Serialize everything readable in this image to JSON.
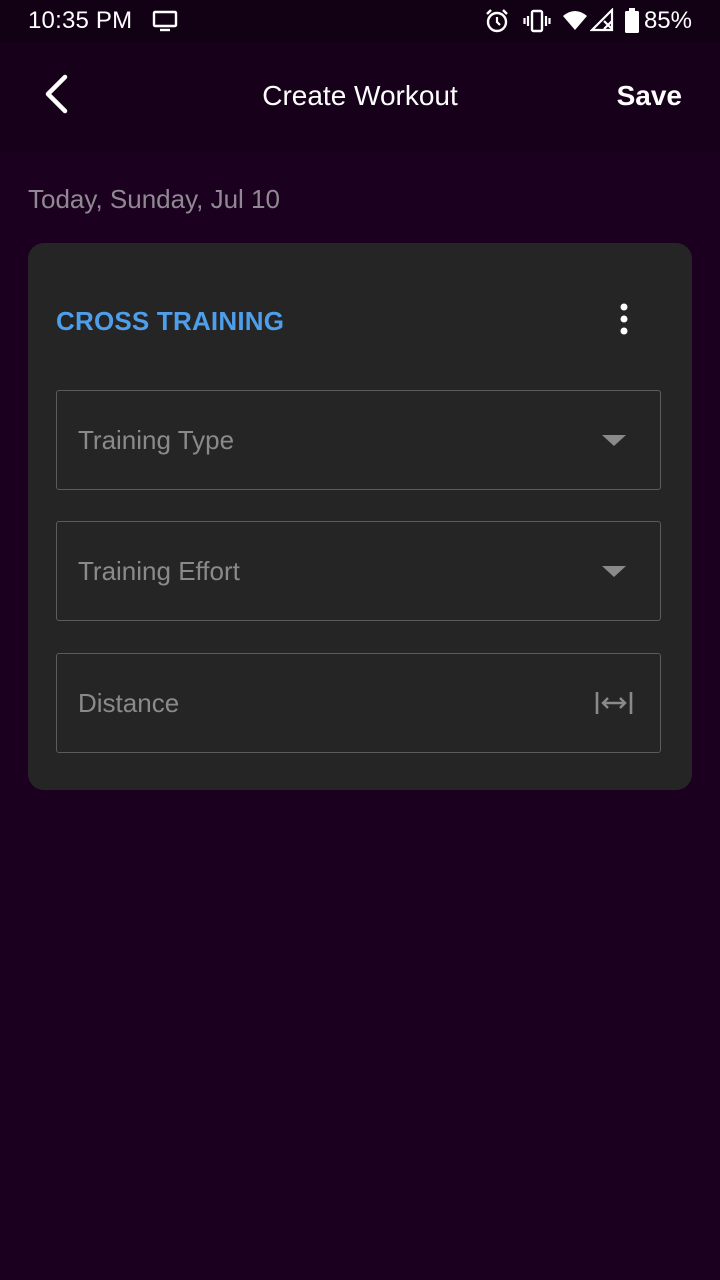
{
  "status_bar": {
    "time": "10:35 PM",
    "battery": "85%",
    "icons": [
      "screen-cast-icon",
      "alarm-icon",
      "vibrate-icon",
      "wifi-icon",
      "signal-icon",
      "battery-icon"
    ]
  },
  "app_bar": {
    "title": "Create Workout",
    "save_label": "Save",
    "back_icon": "back-arrow-icon"
  },
  "date_label": "Today, Sunday, Jul 10",
  "card": {
    "title": "CROSS TRAINING",
    "title_color": "#4e9eea",
    "menu_icon": "more-vertical-icon",
    "fields": [
      {
        "label": "Training Type",
        "icon": "dropdown-arrow-icon"
      },
      {
        "label": "Training Effort",
        "icon": "dropdown-arrow-icon"
      },
      {
        "label": "Distance",
        "icon": "distance-icon"
      }
    ]
  },
  "colors": {
    "background": "#1b0020",
    "card": "#252525",
    "accent": "#4e9eea"
  }
}
